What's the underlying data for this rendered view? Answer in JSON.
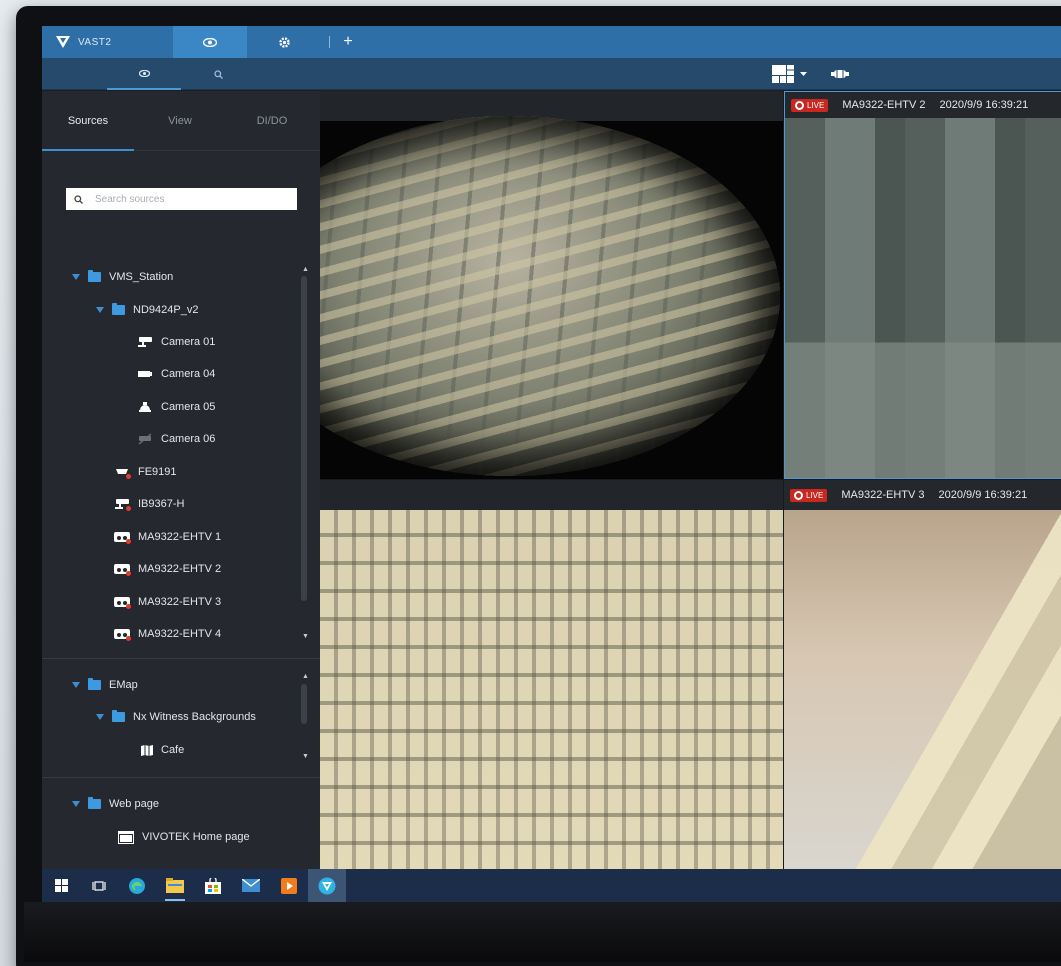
{
  "app": {
    "name": "VAST2",
    "accent_color": "#2f6fa8",
    "tabs": [
      {
        "icon": "eye-icon",
        "active": true
      },
      {
        "icon": "gear-icon",
        "active": false
      },
      {
        "icon": "plus-icon",
        "active": false
      }
    ],
    "subtabs": [
      {
        "icon": "eye-icon",
        "active": true
      },
      {
        "icon": "search-icon",
        "active": false
      }
    ],
    "toolbar": {
      "layout_icon": "grid-layout-icon",
      "dropdown_icon": "chevron-down-icon",
      "camera_icon": "camera-control-icon"
    }
  },
  "sidebar": {
    "tabs": [
      {
        "label": "Sources",
        "active": true
      },
      {
        "label": "View",
        "active": false
      },
      {
        "label": "DI/DO",
        "active": false
      }
    ],
    "search": {
      "placeholder": "Search sources"
    },
    "tree": {
      "station": {
        "label": "VMS_Station",
        "expanded": true
      },
      "nvr": {
        "label": "ND9424P_v2",
        "expanded": true
      },
      "nvr_cams": [
        {
          "label": "Camera 01",
          "icon": "bullet-camera-icon"
        },
        {
          "label": "Camera 04",
          "icon": "box-camera-icon"
        },
        {
          "label": "Camera 05",
          "icon": "dome-camera-icon"
        },
        {
          "label": "Camera 06",
          "icon": "camera-offline-icon"
        }
      ],
      "station_cams": [
        {
          "label": "FE9191",
          "icon": "fisheye-camera-icon"
        },
        {
          "label": "IB9367-H",
          "icon": "bullet-camera-icon"
        },
        {
          "label": "MA9322-EHTV 1",
          "icon": "multi-sensor-camera-icon"
        },
        {
          "label": "MA9322-EHTV 2",
          "icon": "multi-sensor-camera-icon"
        },
        {
          "label": "MA9322-EHTV 3",
          "icon": "multi-sensor-camera-icon"
        },
        {
          "label": "MA9322-EHTV 4",
          "icon": "multi-sensor-camera-icon"
        }
      ],
      "emap": {
        "label": "EMap",
        "expanded": true
      },
      "emap_folder": {
        "label": "Nx Witness Backgrounds",
        "expanded": true
      },
      "emap_items": [
        {
          "label": "Cafe",
          "icon": "map-icon"
        }
      ],
      "webpage": {
        "label": "Web page",
        "expanded": true
      },
      "web_items": [
        {
          "label": "VIVOTEK Home page",
          "icon": "browser-icon"
        }
      ]
    }
  },
  "views": [
    {
      "id": "tile-1",
      "type": "fisheye"
    },
    {
      "id": "tile-2",
      "live_label": "LIVE",
      "camera": "MA9322-EHTV 2",
      "timestamp": "2020/9/9 16:39:21",
      "selected": true
    },
    {
      "id": "tile-3",
      "type": "scene"
    },
    {
      "id": "tile-4",
      "live_label": "LIVE",
      "camera": "MA9322-EHTV 3",
      "timestamp": "2020/9/9 16:39:21",
      "selected": false
    }
  ],
  "taskbar": {
    "items": [
      {
        "icon": "windows-start-icon"
      },
      {
        "icon": "task-view-icon"
      },
      {
        "icon": "edge-browser-icon"
      },
      {
        "icon": "file-explorer-icon",
        "active": true
      },
      {
        "icon": "store-icon"
      },
      {
        "icon": "mail-icon"
      },
      {
        "icon": "media-player-icon"
      },
      {
        "icon": "vast-app-icon",
        "focused": true
      }
    ]
  }
}
